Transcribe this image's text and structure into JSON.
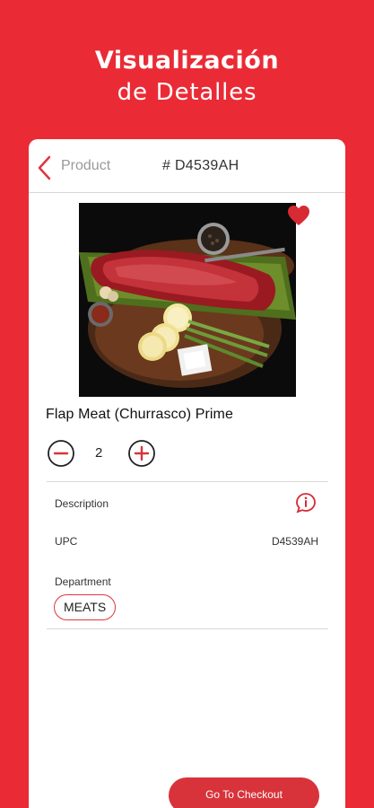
{
  "headline": {
    "line1": "Visualización",
    "line2": "de Detalles"
  },
  "nav": {
    "back_label": "Product",
    "product_id": "# D4539AH"
  },
  "product": {
    "name": "Flap Meat (Churrasco) Prime",
    "quantity": "2",
    "favorite": true
  },
  "details": {
    "description_label": "Description",
    "upc_label": "UPC",
    "upc_value": "D4539AH",
    "department_label": "Department",
    "department_value": "MEATS"
  },
  "checkout": {
    "label": "Go To Checkout"
  },
  "colors": {
    "brand_red": "#ea2b35",
    "button_red": "#d8333b"
  },
  "icons": [
    "chevron-left-icon",
    "heart-icon",
    "minus-circle-icon",
    "plus-circle-icon",
    "info-icon"
  ]
}
